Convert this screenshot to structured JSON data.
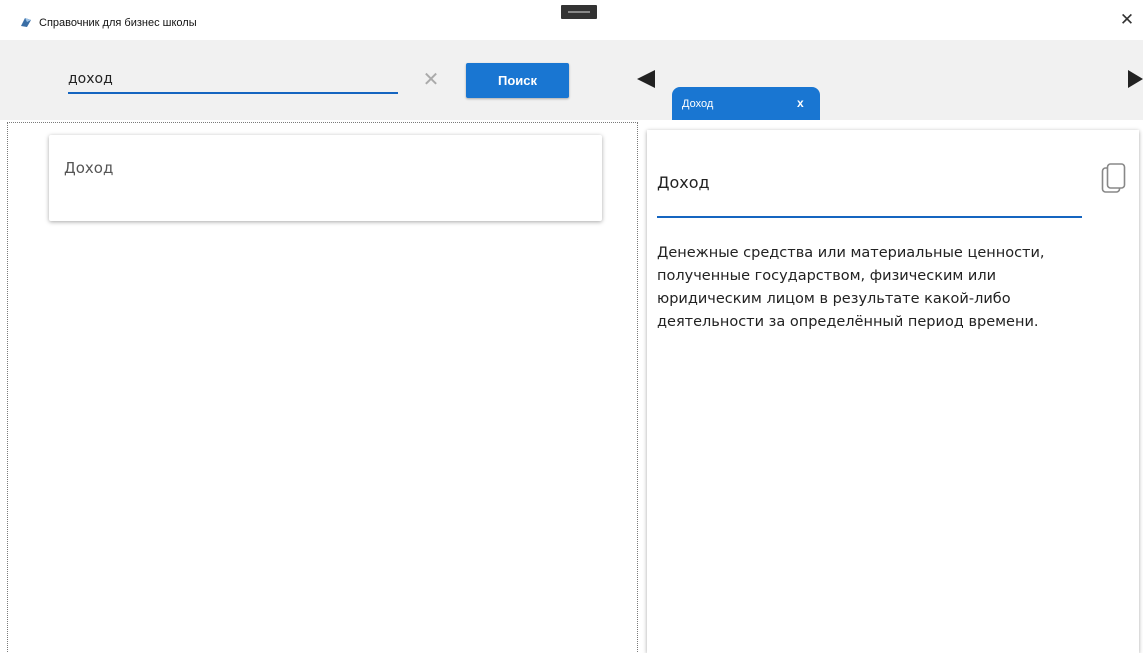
{
  "window": {
    "title": "Справочник для бизнес школы",
    "close_label": "✕"
  },
  "search": {
    "value": "доход",
    "placeholder": "",
    "clear_label": "✕",
    "button_label": "Поиск"
  },
  "tabs": [
    {
      "label": "Доход",
      "close_label": "x"
    }
  ],
  "results": [
    {
      "title": "Доход"
    }
  ],
  "article": {
    "title": "Доход",
    "body": "Денежные средства или материальные ценности, полученные государством, физическим или юридическим лицом в результате какой-либо деятельности за определённый период времени."
  },
  "colors": {
    "accent": "#1976d2",
    "toolbar_bg": "#f1f1f1"
  },
  "icons": {
    "app": "app-logo-icon",
    "nav_left": "arrow-left-icon",
    "nav_right": "arrow-right-icon",
    "copy": "copy-icon"
  }
}
